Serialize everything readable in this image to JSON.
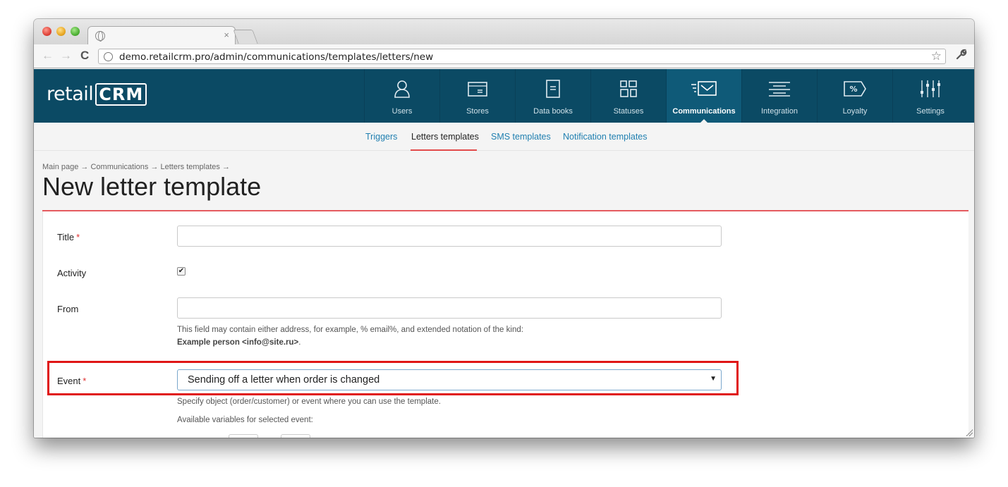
{
  "browser": {
    "tab_close": "×",
    "url": "demo.retailcrm.pro/admin/communications/templates/letters/new",
    "back": "←",
    "forward": "→",
    "reload": "C",
    "star": "☆",
    "wrench": "🔧"
  },
  "app": {
    "logo_text": "retail",
    "logo_crm": "CRM"
  },
  "main_nav": [
    {
      "label": "Users",
      "icon": "user-icon"
    },
    {
      "label": "Stores",
      "icon": "store-icon"
    },
    {
      "label": "Data books",
      "icon": "book-icon"
    },
    {
      "label": "Statuses",
      "icon": "grid-icon"
    },
    {
      "label": "Communications",
      "icon": "mail-icon",
      "active": true
    },
    {
      "label": "Integration",
      "icon": "integration-icon"
    },
    {
      "label": "Loyalty",
      "icon": "percent-tag-icon"
    },
    {
      "label": "Settings",
      "icon": "sliders-icon"
    }
  ],
  "sub_nav": [
    {
      "label": "Triggers"
    },
    {
      "label": "Letters templates",
      "active": true
    },
    {
      "label": "SMS templates"
    },
    {
      "label": "Notification templates"
    }
  ],
  "breadcrumb": "Main page → Communications → Letters templates →",
  "page_title": "New letter template",
  "form": {
    "title_label": "Title",
    "required_mark": "*",
    "title_value": "",
    "activity_label": "Activity",
    "activity_checked": true,
    "activity_mark": "✔",
    "from_label": "From",
    "from_value": "",
    "from_hint_line1": "This field may contain either address, for example, % email%, and extended notation of the kind:",
    "from_hint_example": "Example person <info@site.ru>",
    "from_hint_end": ".",
    "event_label": "Event",
    "event_value": "Sending off a letter when order is changed",
    "event_caret": "▼",
    "event_hint": "Specify object (order/customer) or event where you can use the template.",
    "variables_label": "Available variables for selected event:"
  },
  "colors": {
    "header_bg": "#0b4a64",
    "active_nav_bg": "#0f5a78",
    "link": "#1f7fb0",
    "accent_rule": "#e55a5f",
    "highlight": "#e01616"
  }
}
